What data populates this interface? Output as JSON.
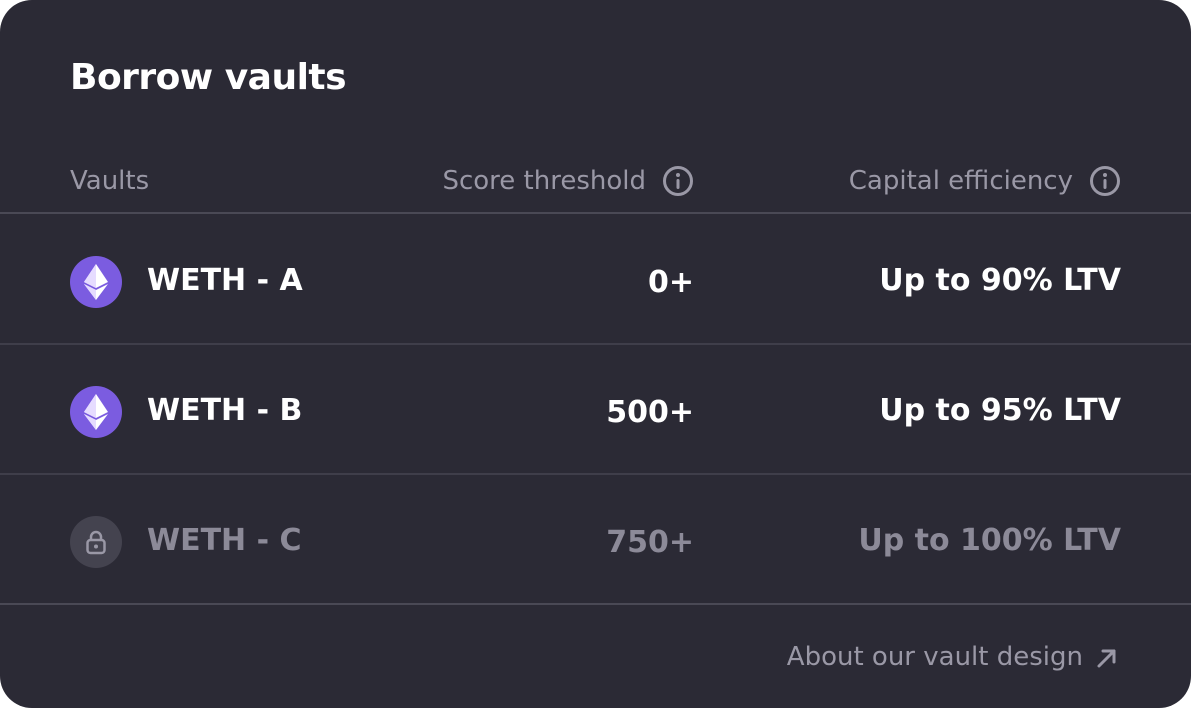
{
  "card": {
    "title": "Borrow vaults"
  },
  "table": {
    "headers": {
      "vaults": "Vaults",
      "score_threshold": "Score threshold",
      "capital_efficiency": "Capital efficiency"
    },
    "rows": [
      {
        "icon": "ethereum-icon",
        "name": "WETH - A",
        "score": "0+",
        "capital": "Up to 90% LTV",
        "locked": false
      },
      {
        "icon": "ethereum-icon",
        "name": "WETH - B",
        "score": "500+",
        "capital": "Up to 95% LTV",
        "locked": false
      },
      {
        "icon": "lock-icon",
        "name": "WETH - C",
        "score": "750+",
        "capital": "Up to 100% LTV",
        "locked": true
      }
    ]
  },
  "footer": {
    "link_label": "About our vault design"
  },
  "colors": {
    "card_background": "#2b2a35",
    "accent_purple": "#7b5ce0",
    "muted_text": "#9a98a6",
    "primary_text": "#ffffff"
  }
}
